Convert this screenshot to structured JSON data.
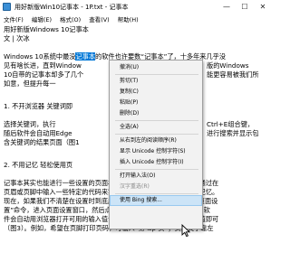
{
  "window": {
    "title": "用好新版Win10记事本 - 1P.txt - 记事本",
    "minimize": "—",
    "maximize": "☐",
    "close": "✕"
  },
  "menubar": [
    "文件(F)",
    "编辑(E)",
    "格式(O)",
    "查看(V)",
    "帮助(H)"
  ],
  "editor": {
    "lines": [
      "用好新版Windows 10记事本",
      "文 | 次冰",
      "",
      "Windows 10系统中最没",
      "见有啥长进，直到Window",
      "10自带的记事本却多了几个",
      "如意，但提升每一",
      "",
      "1. 不开浏览器  关键词即",
      "",
      "选择关键词，执行",
      "随后软件会自动用Edge",
      "含关键词的结果页面（图1",
      "",
      "2. 不用记忆  轻松使用页",
      "",
      "记事本其实也能进行一些设置的页面格式辅助设置，我们知道，它时通过在",
      "页眉或页脚中输入一些特定的代码来实现的，但是这些代码可能不好记忆。",
      "现在，如果我们不清楚在设置时到底应该用什么代码，可通过“文件-页面设",
      "置”命令，进入页面设置窗口，然后点击“输入值”链接（图2）。之后，软",
      "件会自动用浏览器打开可用的输入值说明页面，从中引用必要的输入值即可",
      "（图3）。例如，希望在页脚打印页码，可输入“第 &p 页”；页码文字靠左"
    ],
    "selected_word": "记事本",
    "line4_rest": "的软件也许要数“记事本”了，十多年来几乎没",
    "line5_rest": "版的Windows",
    "line6_rest": "能更容易被我们所",
    "line10_rest": "Ctrl+E组合键，",
    "line11_rest": "进行搜索并显示包"
  },
  "context_menu": {
    "items": [
      {
        "label": "撤消(U)",
        "disabled": false
      },
      {
        "label": "剪切(T)",
        "disabled": false
      },
      {
        "label": "复制(C)",
        "disabled": false
      },
      {
        "label": "粘贴(P)",
        "disabled": false
      },
      {
        "label": "删除(D)",
        "disabled": false
      },
      {
        "label": "全选(A)",
        "disabled": false
      },
      {
        "label": "从右到左的阅读顺序(R)",
        "disabled": false
      },
      {
        "label": "显示 Unicode 控制字符(S)",
        "disabled": false
      },
      {
        "label": "插入 Unicode 控制字符(I)",
        "disabled": false
      },
      {
        "label": "打开输入法(O)",
        "disabled": false
      },
      {
        "label": "汉字重选(R)",
        "disabled": true
      },
      {
        "label": "使用 Bing 搜索...",
        "disabled": false
      }
    ],
    "highlighted": "使用 Bing 搜索..."
  }
}
